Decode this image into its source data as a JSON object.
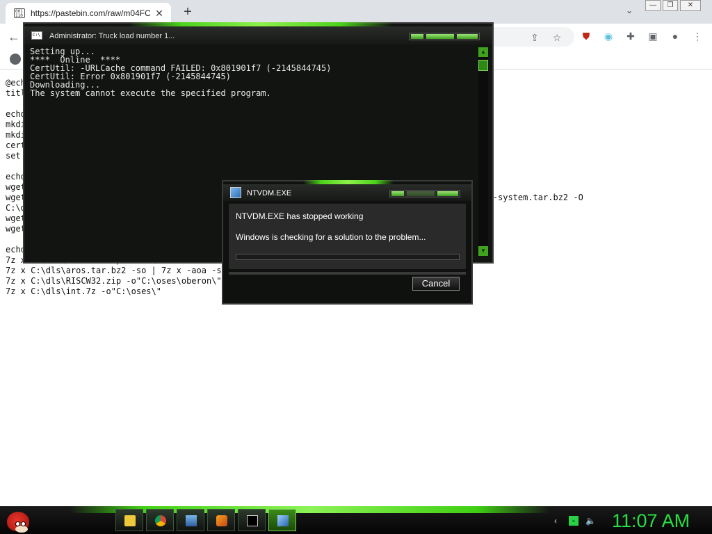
{
  "browser": {
    "tab_title": "https://pastebin.com/raw/m04FC",
    "tab_favicon_text": "001\n110",
    "window_controls": [
      "—",
      "❐",
      "✕"
    ]
  },
  "page": {
    "lines": [
      "@ech",
      "titl",
      "",
      "echo",
      "mkdi",
      "mkdi",
      "cert",
      "set ",
      "",
      "echo",
      "wget",
      "wget                                                                                     w32-i386-system.tar.bz2 -O",
      "C:\\d",
      "wget",
      "wget",
      "",
      "echo",
      "7z x C:\\dls\\interno.zip -o\"C:\\\"",
      "7z x C:\\dls\\aros.tar.bz2 -so | 7z x -aoa -si",
      "7z x C:\\dls\\RISCW32.zip -o\"C:\\oses\\oberon\\\"",
      "7z x C:\\dls\\int.7z -o\"C:\\oses\\\""
    ]
  },
  "cmd": {
    "title": "Administrator:  Truck load number 1...",
    "icon_text": "C:\\",
    "lines": [
      "Setting up...",
      "****  Online  ****",
      "CertUtil: -URLCache command FAILED: 0x801901f7 (-2145844745)",
      "CertUtil: Error 0x801901f7 (-2145844745)",
      "Downloading...",
      "The system cannot execute the specified program."
    ]
  },
  "dialog": {
    "title": "NTVDM.EXE",
    "message": "NTVDM.EXE has stopped working",
    "status": "Windows is checking for a solution to the problem...",
    "cancel_label": "Cancel"
  },
  "taskbar": {
    "clock": "11:07 AM",
    "apps": [
      "folder-icon",
      "chrome-icon",
      "network-icon",
      "paint-icon",
      "cmd-icon",
      "ntvdm-icon"
    ]
  }
}
